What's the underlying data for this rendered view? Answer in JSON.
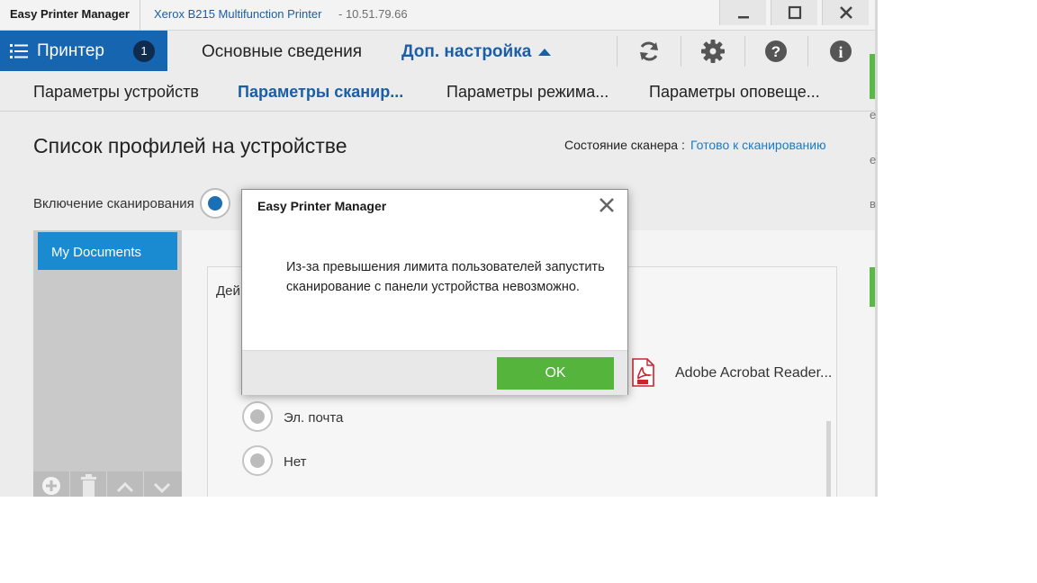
{
  "titlebar": {
    "app_name": "Easy Printer Manager",
    "printer_name": "Xerox B215 Multifunction Printer",
    "printer_ip": "- 10.51.79.66"
  },
  "main_nav": {
    "printer_tab_label": "Принтер",
    "printer_badge": "1",
    "basic_tab": "Основные сведения",
    "advanced_tab": "Доп. настройка"
  },
  "sub_nav": {
    "tabs": [
      "Параметры устройств",
      "Параметры сканир...",
      "Параметры режима...",
      "Параметры оповеще..."
    ]
  },
  "content": {
    "heading": "Список профилей на устройстве",
    "scanner_status_label": "Состояние сканера :",
    "scanner_status_value": "Готово к сканированию",
    "scan_enable_label": "Включение сканирования",
    "profile_item": "My Documents",
    "action_label": "Дей",
    "option_email": "Эл. почта",
    "option_none": "Нет",
    "acrobat_label": "Adobe Acrobat Reader..."
  },
  "right_strip": {
    "frags": [
      "е",
      "е",
      "в"
    ]
  },
  "modal": {
    "title": "Easy Printer Manager",
    "message": "Из-за превышения лимита пользователей запустить сканирование с панели устройства невозможно.",
    "ok_label": "OK"
  },
  "colors": {
    "accent_blue": "#1565b0",
    "link_blue": "#1b5ea6",
    "ok_green": "#54b43c"
  }
}
